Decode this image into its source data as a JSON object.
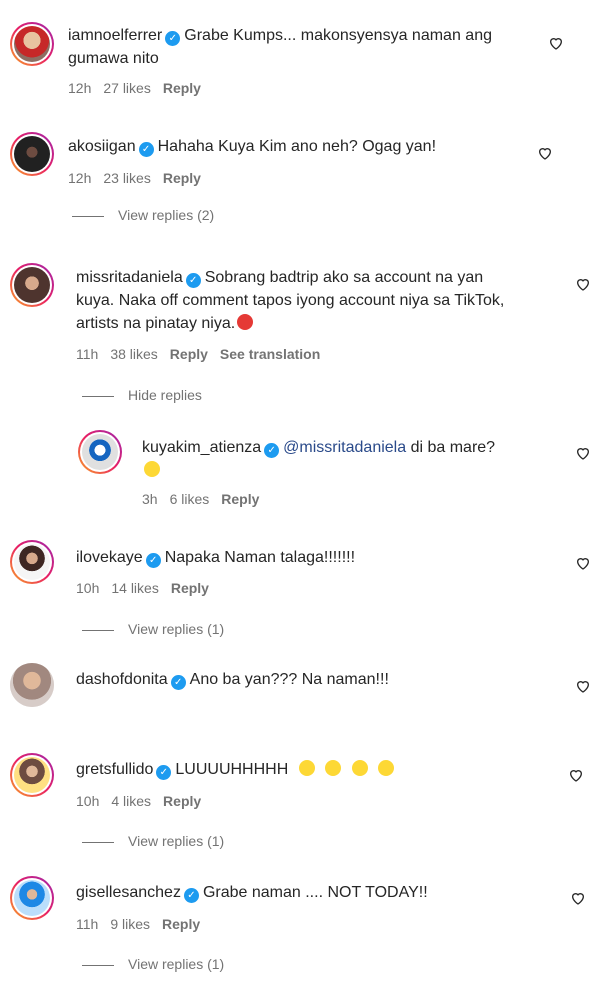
{
  "comments": [
    {
      "user": "iamnoelferrer",
      "text": "Grabe Kumps... makonsyensya naman ang",
      "text2": "gumawa nito",
      "time": "12h",
      "likes": "27 likes",
      "reply": "Reply"
    },
    {
      "user": "akosiigan",
      "text": "Hahaha Kuya Kim ano neh? Ogag yan!",
      "time": "12h",
      "likes": "23 likes",
      "reply": "Reply",
      "view_replies": "View replies (2)"
    },
    {
      "user": "missritadaniela",
      "text": "Sobrang badtrip ako sa account na yan",
      "text2": "kuya. Naka off comment tapos iyong account niya sa TikTok,",
      "text3": "artists na pinatay niya.",
      "time": "11h",
      "likes": "38 likes",
      "reply": "Reply",
      "translation": "See translation",
      "hide_replies": "Hide replies"
    },
    {
      "user": "kuyakim_atienza",
      "mention": "@missritadaniela",
      "text": "di ba mare?",
      "time": "3h",
      "likes": "6 likes",
      "reply": "Reply"
    },
    {
      "user": "ilovekaye",
      "text": "Napaka Naman talaga!!!!!!!",
      "time": "10h",
      "likes": "14 likes",
      "reply": "Reply",
      "view_replies": "View replies (1)"
    },
    {
      "user": "dashofdonita",
      "text": "Ano ba yan??? Na naman!!!"
    },
    {
      "user": "gretsfullido",
      "text": "LUUUUHHHHH",
      "time": "10h",
      "likes": "4 likes",
      "reply": "Reply",
      "view_replies": "View replies (1)"
    },
    {
      "user": "gisellesanchez",
      "text": "Grabe naman .... NOT TODAY!!",
      "time": "11h",
      "likes": "9 likes",
      "reply": "Reply",
      "view_replies": "View replies (1)"
    }
  ],
  "colors": {
    "verified": "#1d9bf0",
    "meta": "#737373",
    "mention": "#2a4a8a"
  },
  "icons": {
    "heart": "heart-outline-icon",
    "verified": "verified-badge-icon"
  }
}
